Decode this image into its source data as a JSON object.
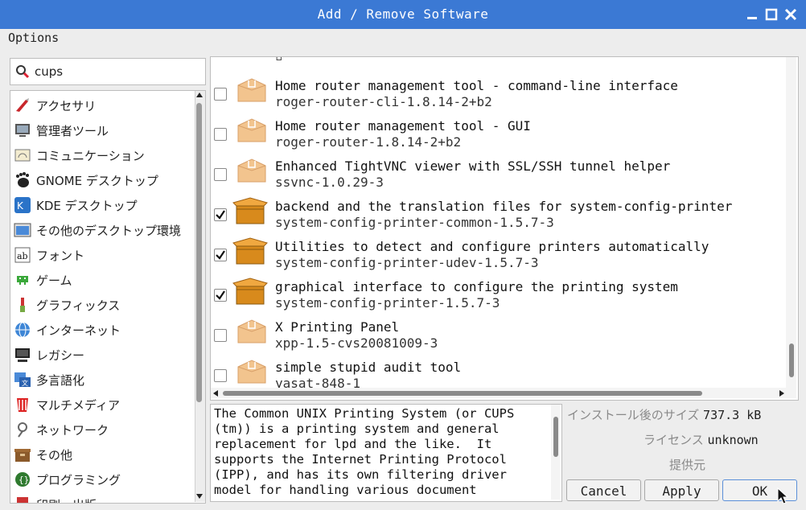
{
  "window": {
    "title": "Add / Remove Software"
  },
  "menubar": {
    "options": "Options"
  },
  "search": {
    "value": "cups"
  },
  "categories": [
    {
      "label": "アクセサリ",
      "icon": "accessories-knife-icon"
    },
    {
      "label": "管理者ツール",
      "icon": "admin-tools-icon"
    },
    {
      "label": "コミュニケーション",
      "icon": "communication-icon"
    },
    {
      "label": "GNOME デスクトップ",
      "icon": "gnome-foot-icon"
    },
    {
      "label": "KDE デスクトップ",
      "icon": "kde-icon"
    },
    {
      "label": "その他のデスクトップ環境",
      "icon": "desktop-environment-icon"
    },
    {
      "label": "フォント",
      "icon": "font-icon"
    },
    {
      "label": "ゲーム",
      "icon": "game-invader-icon"
    },
    {
      "label": "グラフィックス",
      "icon": "graphics-brush-icon"
    },
    {
      "label": "インターネット",
      "icon": "internet-globe-icon"
    },
    {
      "label": "レガシー",
      "icon": "legacy-computer-icon"
    },
    {
      "label": "多言語化",
      "icon": "localization-icon"
    },
    {
      "label": "マルチメディア",
      "icon": "multimedia-icon"
    },
    {
      "label": "ネットワーク",
      "icon": "network-icon"
    },
    {
      "label": "その他",
      "icon": "other-box-icon"
    },
    {
      "label": "プログラミング",
      "icon": "programming-icon"
    },
    {
      "label": "印刷・出版",
      "icon": "publishing-icon"
    }
  ],
  "packages": [
    {
      "desc": "Home router management tool - command-line interface",
      "name": "roger-router-cli-1.8.14-2+b2",
      "installed": false
    },
    {
      "desc": "Home router management tool - GUI",
      "name": "roger-router-1.8.14-2+b2",
      "installed": false
    },
    {
      "desc": "Enhanced TightVNC viewer with SSL/SSH tunnel helper",
      "name": "ssvnc-1.0.29-3",
      "installed": false
    },
    {
      "desc": "backend and the translation files for system-config-printer",
      "name": "system-config-printer-common-1.5.7-3",
      "installed": true
    },
    {
      "desc": "Utilities to detect and configure printers automatically",
      "name": "system-config-printer-udev-1.5.7-3",
      "installed": true
    },
    {
      "desc": "graphical interface to configure the printing system",
      "name": "system-config-printer-1.5.7-3",
      "installed": true
    },
    {
      "desc": "X Printing Panel",
      "name": "xpp-1.5-cvs20081009-3",
      "installed": false
    },
    {
      "desc": "simple stupid audit tool",
      "name": "yasat-848-1",
      "installed": false
    }
  ],
  "description": "The Common UNIX Printing System (or CUPS\n(tm)) is a printing system and general\nreplacement for lpd and the like.  It\nsupports the Internet Printing Protocol\n(IPP), and has its own filtering driver\nmodel for handling various document",
  "info": {
    "size_label": "インストール後のサイズ",
    "size_value": "737.3 kB",
    "license_label": "ライセンス",
    "license_value": "unknown",
    "provider_label": "提供元"
  },
  "buttons": {
    "cancel": "Cancel",
    "apply": "Apply",
    "ok": "OK"
  },
  "colors": {
    "titlebar": "#3b79d4",
    "box_installed": "#d88a1c",
    "box_available": "#f2c48e"
  }
}
